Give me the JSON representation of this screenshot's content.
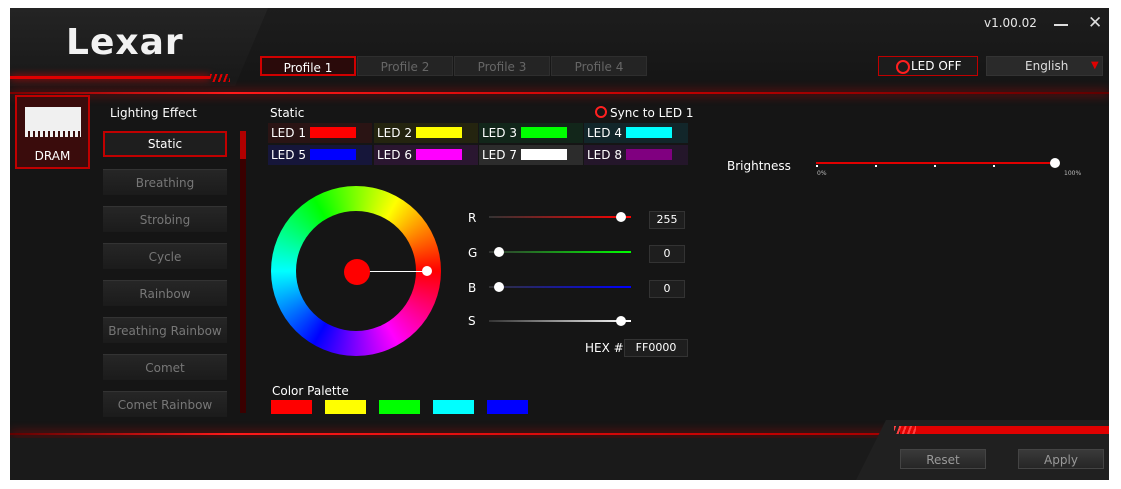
{
  "window": {
    "version": "v1.00.02",
    "minimize_icon": "minimize-icon",
    "close_icon": "close-icon",
    "close_glyph": "✕"
  },
  "brand": {
    "logo_text": "Lexar"
  },
  "profiles": [
    {
      "label": "Profile 1",
      "active": true
    },
    {
      "label": "Profile 2",
      "active": false
    },
    {
      "label": "Profile 3",
      "active": false
    },
    {
      "label": "Profile 4",
      "active": false
    }
  ],
  "led_off": {
    "label": "LED OFF"
  },
  "language": {
    "selected": "English",
    "arrow": "▼"
  },
  "device": {
    "label": "DRAM",
    "icon": "ram-module-icon"
  },
  "lighting": {
    "title": "Lighting Effect",
    "effects": [
      "Static",
      "Breathing",
      "Strobing",
      "Cycle",
      "Rainbow",
      "Breathing Rainbow",
      "Comet",
      "Comet Rainbow"
    ],
    "selected": "Static"
  },
  "static_panel": {
    "title": "Static",
    "sync_label": "Sync to LED 1",
    "leds": [
      {
        "label": "LED 1",
        "color": "#ff0000",
        "bg": "#2a1414"
      },
      {
        "label": "LED 2",
        "color": "#ffff00",
        "bg": "#24240f"
      },
      {
        "label": "LED 3",
        "color": "#00ff00",
        "bg": "#12261a"
      },
      {
        "label": "LED 4",
        "color": "#00ffff",
        "bg": "#12262a"
      },
      {
        "label": "LED 5",
        "color": "#0000ff",
        "bg": "#16163a"
      },
      {
        "label": "LED 6",
        "color": "#ff00ff",
        "bg": "#2a1630"
      },
      {
        "label": "LED 7",
        "color": "#ffffff",
        "bg": "#2c2c2c"
      },
      {
        "label": "LED 8",
        "color": "#800080",
        "bg": "#24162a"
      }
    ]
  },
  "color_picker": {
    "channels": [
      {
        "label": "R",
        "value": "255",
        "fraction": 1.0,
        "color": "#ff0000"
      },
      {
        "label": "G",
        "value": "0",
        "fraction": 0.0,
        "color": "#00ff00"
      },
      {
        "label": "B",
        "value": "0",
        "fraction": 0.0,
        "color": "#0000ff"
      },
      {
        "label": "S",
        "value": "",
        "fraction": 1.0,
        "color": "#ffffff"
      }
    ],
    "hex_label": "HEX #",
    "hex_value": "FF0000",
    "selected_color": "#ff0000"
  },
  "palette": {
    "title": "Color Palette",
    "colors": [
      "#ff0000",
      "#ffff00",
      "#00ff00",
      "#00ffff",
      "#0000ff"
    ]
  },
  "brightness": {
    "label": "Brightness",
    "min_label": "0%",
    "max_label": "100%",
    "value_percent": 100
  },
  "footer": {
    "reset_label": "Reset",
    "apply_label": "Apply"
  }
}
